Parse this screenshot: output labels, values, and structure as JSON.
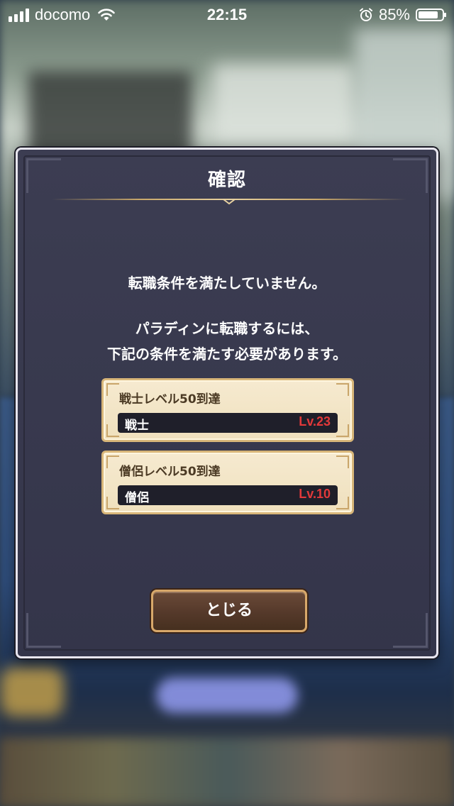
{
  "status_bar": {
    "carrier": "docomo",
    "time": "22:15",
    "battery": "85%",
    "battery_level": 0.85
  },
  "dialog": {
    "title": "確認",
    "message_line1": "転職条件を満たしていません。",
    "message_line2": "パラディンに転職するには、",
    "message_line3": "下記の条件を満たす必要があります。",
    "requirements": [
      {
        "title": "戦士レベル50到達",
        "name": "戦士",
        "level": "Lv.23"
      },
      {
        "title": "僧侶レベル50到達",
        "name": "僧侶",
        "level": "Lv.10"
      }
    ],
    "close_label": "とじる"
  },
  "colors": {
    "level_text": "#e2393a",
    "card_border": "#d8b679",
    "button_border": "#d8a86a"
  }
}
